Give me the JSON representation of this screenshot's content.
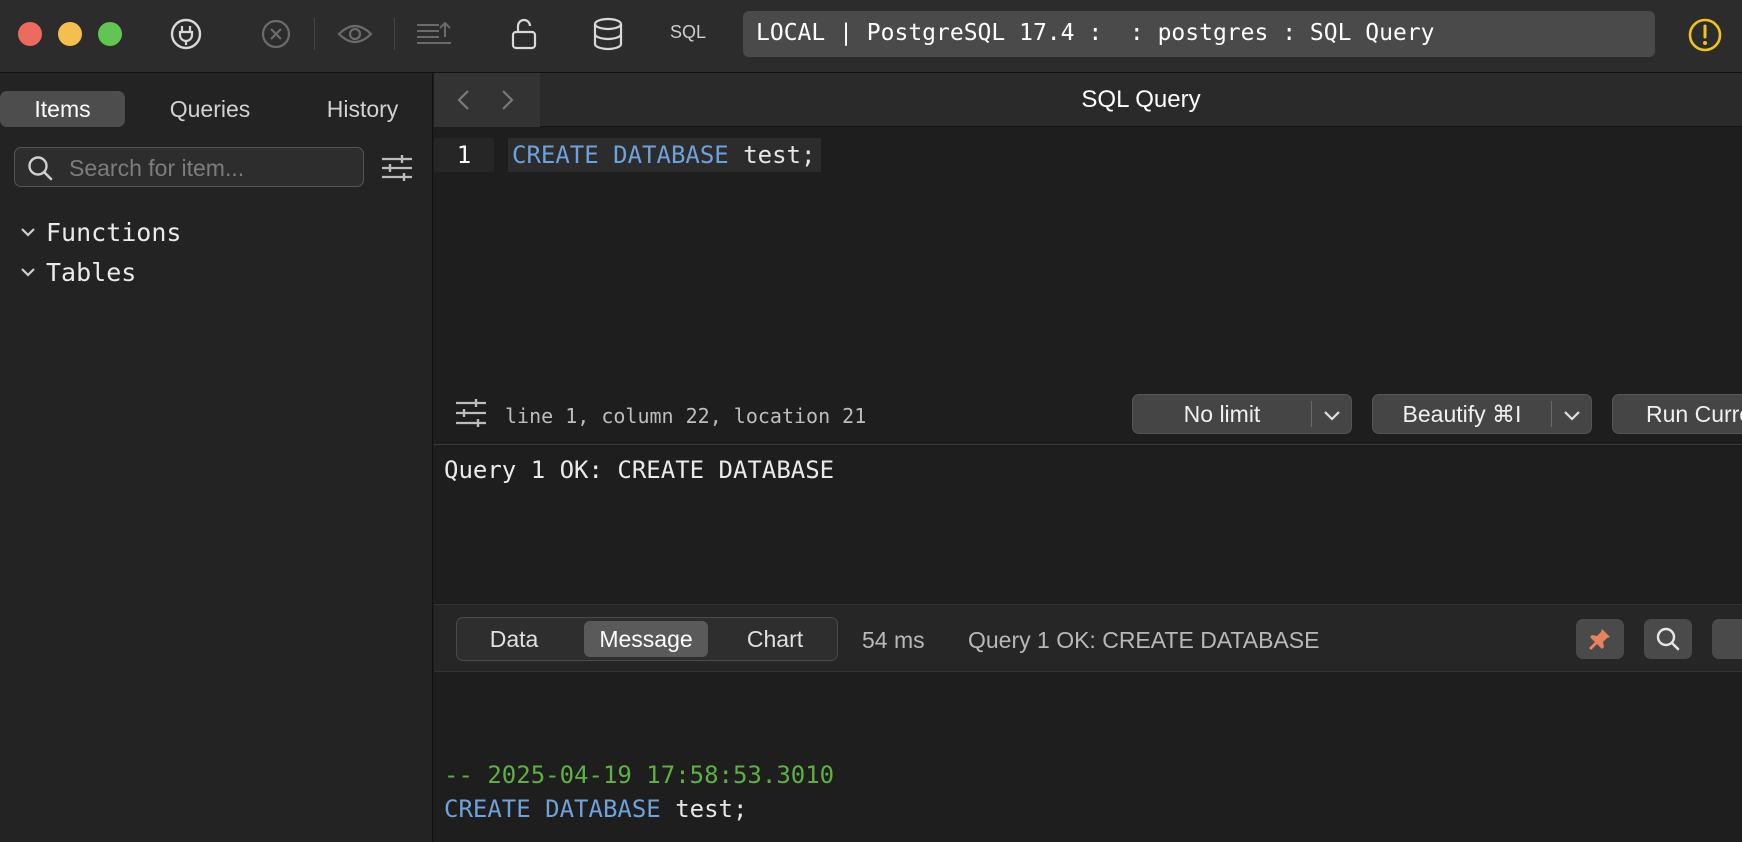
{
  "toolbar": {
    "sql_label": "SQL",
    "connection": "LOCAL | PostgreSQL 17.4 :  : postgres : SQL Query"
  },
  "sidebar": {
    "tabs": [
      {
        "label": "Items",
        "active": true
      },
      {
        "label": "Queries",
        "active": false
      },
      {
        "label": "History",
        "active": false
      }
    ],
    "search_placeholder": "Search for item...",
    "tree": [
      {
        "label": "Functions"
      },
      {
        "label": "Tables"
      }
    ]
  },
  "editor": {
    "title": "SQL Query",
    "line_number": "1",
    "code_keyword": "CREATE DATABASE",
    "code_rest": " test;",
    "status": "line 1, column 22, location 21",
    "limit_label": "No limit",
    "beautify_label": "Beautify ⌘I",
    "run_label": "Run Current"
  },
  "messages": {
    "result": "Query 1 OK: CREATE DATABASE"
  },
  "results": {
    "tabs": [
      {
        "label": "Data",
        "active": false
      },
      {
        "label": "Message",
        "active": true
      },
      {
        "label": "Chart",
        "active": false
      }
    ],
    "time": "54 ms",
    "message": "Query 1 OK: CREATE DATABASE"
  },
  "log": {
    "timestamp": "-- 2025-04-19 17:58:53.3010",
    "keyword": "CREATE DATABASE",
    "rest": " test;"
  },
  "colors": {
    "keyword": "#6ea2dc",
    "comment": "#5fb043",
    "warning": "#f2c418",
    "pin": "#e8825f"
  },
  "icons": {
    "connect": "plug-icon",
    "cancel": "close-circle-icon",
    "preview": "eye-icon",
    "export": "export-lines-icon",
    "lock": "unlock-icon",
    "database": "database-icon",
    "warning": "warning-icon",
    "pin": "pin-icon",
    "search": "search-icon"
  }
}
